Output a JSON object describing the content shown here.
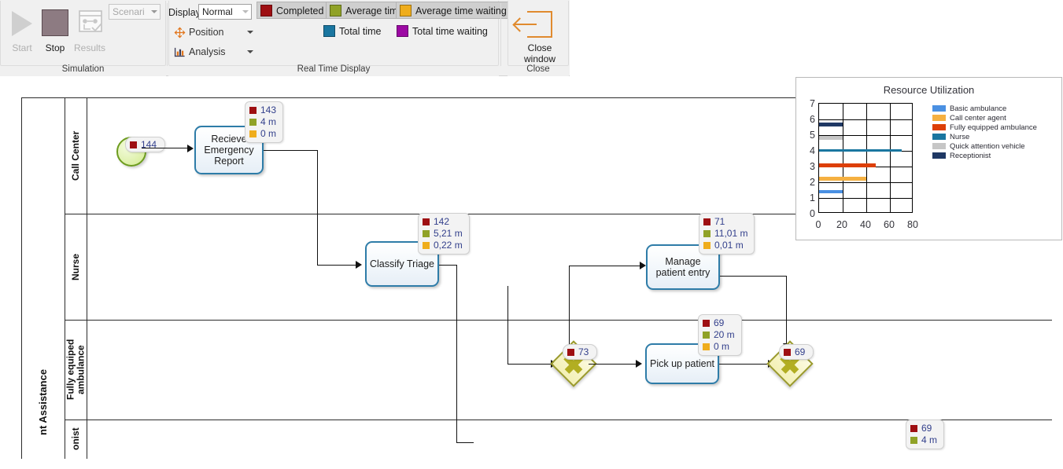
{
  "ribbon": {
    "groups": [
      {
        "caption": "Simulation"
      },
      {
        "caption": "Real Time Display"
      },
      {
        "caption": "Close"
      }
    ],
    "simulation": {
      "start_label": "Start",
      "stop_label": "Stop",
      "results_label": "Results",
      "scenario_value": "Scenari",
      "scenario_placeholder": "Scenario"
    },
    "display": {
      "display_label": "Display",
      "mode_value": "Normal",
      "position_label": "Position",
      "analysis_label": "Analysis",
      "legend": [
        {
          "label": "Completed",
          "color": "#9e0f12",
          "active": true
        },
        {
          "label": "Average time",
          "color": "#90a227",
          "active": true
        },
        {
          "label": "Average time waiting",
          "color": "#efad1c",
          "active": true
        },
        {
          "label": "Total time",
          "color": "#1a76a0",
          "active": false
        },
        {
          "label": "Total time waiting",
          "color": "#9c09a3",
          "active": false
        }
      ]
    },
    "close": {
      "line1": "Close",
      "line2": "window"
    }
  },
  "diagram": {
    "pool_label": "nt Assistance",
    "lanes": [
      {
        "label": "Call Center"
      },
      {
        "label": "Nurse"
      },
      {
        "label": "Fully equiped ambulance"
      },
      {
        "label": "onist"
      }
    ],
    "nodes": {
      "start": {
        "stats": [
          {
            "color": "#9e0f12",
            "value": "144"
          }
        ]
      },
      "recieve_emergency_report": {
        "label": "Recieve Emergency Report",
        "stats": [
          {
            "color": "#9e0f12",
            "value": "143"
          },
          {
            "color": "#90a227",
            "value": "4 m"
          },
          {
            "color": "#efad1c",
            "value": "0 m"
          }
        ]
      },
      "classify_triage": {
        "label": "Classify Triage",
        "stats": [
          {
            "color": "#9e0f12",
            "value": "142"
          },
          {
            "color": "#90a227",
            "value": "5,21 m"
          },
          {
            "color": "#efad1c",
            "value": "0,22 m"
          }
        ]
      },
      "manage_patient_entry": {
        "label": "Manage patient entry",
        "stats": [
          {
            "color": "#9e0f12",
            "value": "71"
          },
          {
            "color": "#90a227",
            "value": "11,01 m"
          },
          {
            "color": "#efad1c",
            "value": "0,01 m"
          }
        ]
      },
      "gateway_split": {
        "stats": [
          {
            "color": "#9e0f12",
            "value": "73"
          }
        ]
      },
      "pick_up_patient": {
        "label": "Pick up patient",
        "stats": [
          {
            "color": "#9e0f12",
            "value": "69"
          },
          {
            "color": "#90a227",
            "value": "20 m"
          },
          {
            "color": "#efad1c",
            "value": "0 m"
          }
        ]
      },
      "gateway_join": {
        "stats": [
          {
            "color": "#9e0f12",
            "value": "69"
          }
        ]
      },
      "bottom_task": {
        "stats": [
          {
            "color": "#9e0f12",
            "value": "69"
          },
          {
            "color": "#90a227",
            "value": "4 m"
          }
        ]
      }
    }
  },
  "chart_data": {
    "type": "bar",
    "orientation": "horizontal",
    "title": "Resource Utilization",
    "xlabel": "",
    "ylabel": "",
    "categories": [
      "Basic ambulance",
      "Call center agent",
      "Fully equipped ambulance",
      "Nurse",
      "Quick attention vehicle",
      "Receptionist"
    ],
    "values": [
      20,
      40,
      48,
      70,
      20,
      20
    ],
    "colors": [
      "#4a90e2",
      "#f5b041",
      "#dd3f07",
      "#1a76a0",
      "#c6c6c6",
      "#1f3864"
    ],
    "y_positions": [
      1.35,
      2.2,
      3.05,
      4.0,
      4.85,
      5.7
    ],
    "xlim": [
      0,
      80
    ],
    "ylim": [
      0,
      7
    ],
    "xticks": [
      "0",
      "20",
      "40",
      "60",
      "80"
    ],
    "yticks": [
      "0",
      "1",
      "2",
      "3",
      "4",
      "5",
      "6",
      "7"
    ],
    "grid": true,
    "legend_position": "right",
    "legend": [
      {
        "label": "Basic ambulance",
        "color": "#4a90e2"
      },
      {
        "label": "Call center agent",
        "color": "#f5b041"
      },
      {
        "label": "Fully equipped ambulance",
        "color": "#dd3f07"
      },
      {
        "label": "Nurse",
        "color": "#1a76a0"
      },
      {
        "label": "Quick attention vehicle",
        "color": "#c6c6c6"
      },
      {
        "label": "Receptionist",
        "color": "#1f3864"
      }
    ]
  }
}
